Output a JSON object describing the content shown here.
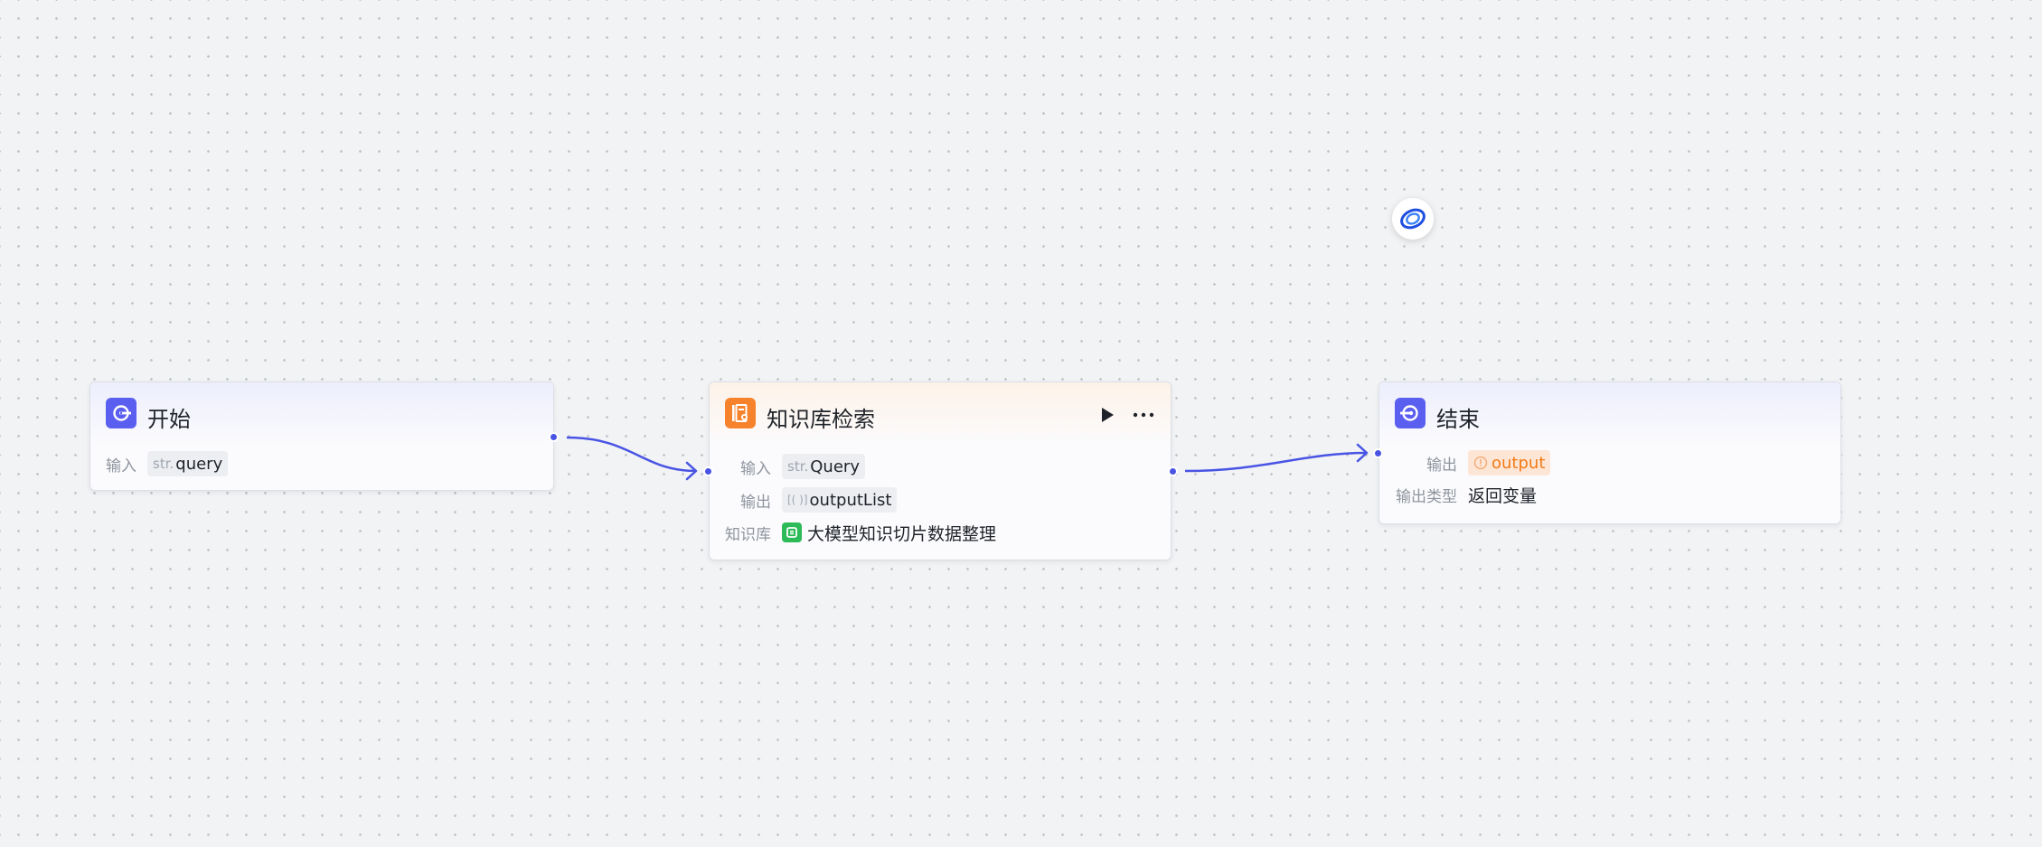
{
  "nodes": {
    "start": {
      "title": "开始",
      "input_label": "输入",
      "input_type": "str.",
      "input_value": "query"
    },
    "kb": {
      "title": "知识库检索",
      "input_label": "输入",
      "input_type": "str.",
      "input_value": "Query",
      "output_label": "输出",
      "output_type": "[( )]",
      "output_value": "outputList",
      "kb_label": "知识库",
      "kb_value": "大模型知识切片数据整理"
    },
    "end": {
      "title": "结束",
      "output_label": "输出",
      "output_value": "output",
      "output_type_label": "输出类型",
      "output_type_value": "返回变量"
    }
  },
  "icons": {
    "start": "start-node-icon",
    "kb": "knowledge-search-icon",
    "end": "end-node-icon",
    "run": "play-icon",
    "more": "more-icon",
    "floating": "assistant-logo-icon",
    "output_warning": "warning-circle-icon"
  },
  "colors": {
    "accent": "#4954e4",
    "node_blue": "#5b5ff0",
    "node_orange": "#f7822c",
    "kb_green": "#2dba59",
    "warning_orange": "#f27a16",
    "canvas": "#f2f3f5"
  }
}
